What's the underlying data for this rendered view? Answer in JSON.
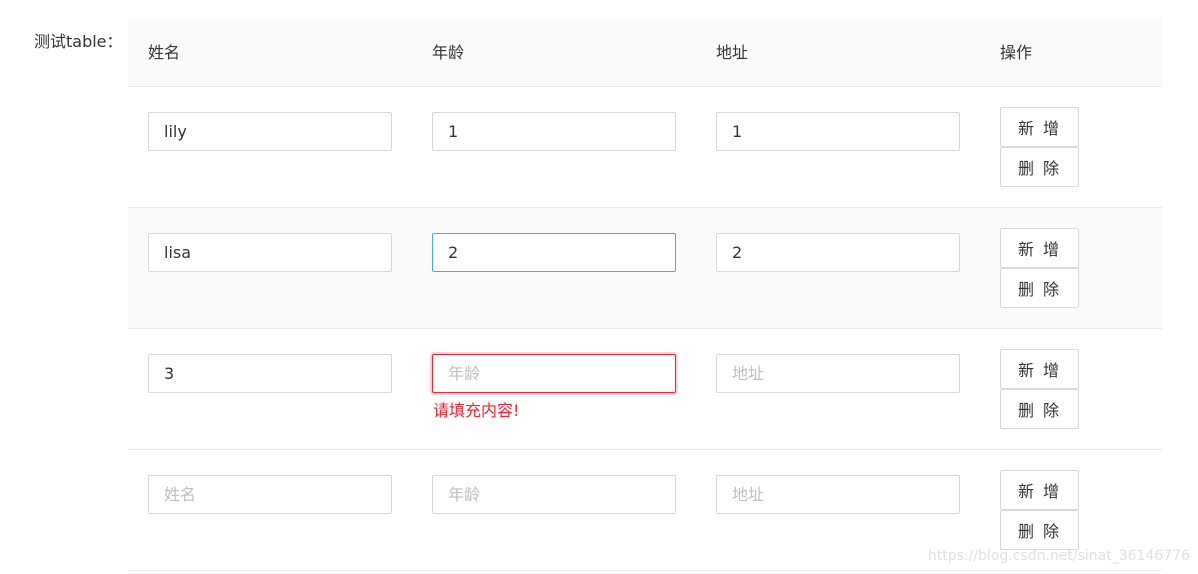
{
  "form": {
    "label": "测试table："
  },
  "table": {
    "headers": [
      "姓名",
      "年龄",
      "地址",
      "操作"
    ],
    "add_label": "新 增",
    "delete_label": "删 除",
    "rows": [
      {
        "name": {
          "value": "lily",
          "placeholder": "姓名"
        },
        "age": {
          "value": "1",
          "placeholder": "年龄"
        },
        "address": {
          "value": "1",
          "placeholder": "地址"
        }
      },
      {
        "name": {
          "value": "lisa",
          "placeholder": "姓名"
        },
        "age": {
          "value": "2",
          "placeholder": "年龄"
        },
        "address": {
          "value": "2",
          "placeholder": "地址"
        }
      },
      {
        "name": {
          "value": "3",
          "placeholder": "姓名"
        },
        "age": {
          "value": "",
          "placeholder": "年龄",
          "error": "请填充内容!"
        },
        "address": {
          "value": "",
          "placeholder": "地址"
        }
      },
      {
        "name": {
          "value": "",
          "placeholder": "姓名"
        },
        "age": {
          "value": "",
          "placeholder": "年龄"
        },
        "address": {
          "value": "",
          "placeholder": "地址"
        }
      }
    ]
  },
  "colors": {
    "header_bg": "#fafafa",
    "border": "#d9d9d9",
    "focus_border": "#40a9ff",
    "error": "#f5222d",
    "placeholder": "#bfbfbf"
  },
  "watermark": "https://blog.csdn.net/sinat_36146776"
}
